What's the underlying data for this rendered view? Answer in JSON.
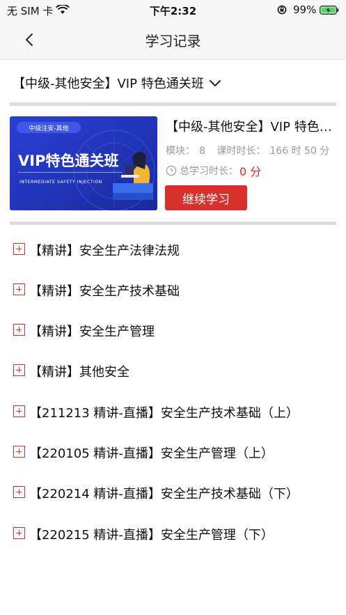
{
  "status_bar": {
    "carrier": "无 SIM 卡",
    "time": "下午2:32",
    "battery": "99%"
  },
  "nav": {
    "title": "学习记录"
  },
  "course_select": {
    "label": "【中级-其他安全】VIP 特色通关班"
  },
  "card": {
    "thumb_tag": "中级注安-其他",
    "thumb_title": "VIP特色通关班",
    "thumb_sub": "INTERMEDIATE SAFETY INJECTION",
    "title": "【中级-其他安全】VIP 特色通关班",
    "modules_label": "模块：",
    "modules_value": "8",
    "duration_label": "课时时长：",
    "duration_value": "166 时 50 分",
    "study_label": "总学习时长：",
    "study_value": "0 分",
    "continue_label": "继续学习"
  },
  "chapters": [
    {
      "label": "【精讲】安全生产法律法规"
    },
    {
      "label": "【精讲】安全生产技术基础"
    },
    {
      "label": "【精讲】安全生产管理"
    },
    {
      "label": "【精讲】其他安全"
    },
    {
      "label": "【211213 精讲-直播】安全生产技术基础（上）"
    },
    {
      "label": "【220105 精讲-直播】安全生产管理（上）"
    },
    {
      "label": "【220214 精讲-直播】安全生产技术基础（下）"
    },
    {
      "label": "【220215 精讲-直播】安全生产管理（下）"
    }
  ],
  "colors": {
    "accent": "#d9302b",
    "highlight": "#e0261f",
    "divider": "#dcdcdc",
    "bar_bg": "#f6f6f6"
  }
}
